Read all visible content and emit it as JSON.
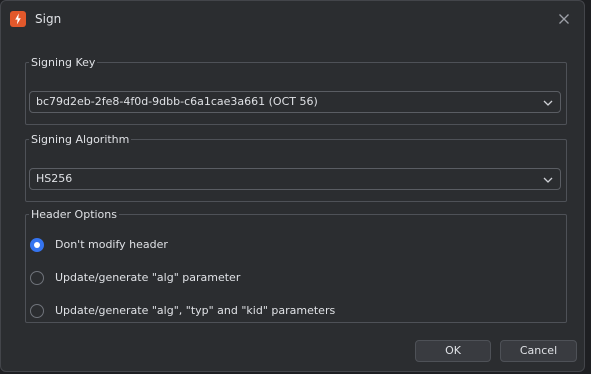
{
  "window": {
    "title": "Sign"
  },
  "signing_key": {
    "legend": "Signing Key",
    "selected": "bc79d2eb-2fe8-4f0d-9dbb-c6a1cae3a661 (OCT 56)"
  },
  "signing_algorithm": {
    "legend": "Signing Algorithm",
    "selected": "HS256"
  },
  "header_options": {
    "legend": "Header Options",
    "options": [
      {
        "label": "Don't modify header",
        "checked": true
      },
      {
        "label": "Update/generate \"alg\" parameter",
        "checked": false
      },
      {
        "label": "Update/generate \"alg\", \"typ\" and \"kid\" parameters",
        "checked": false
      }
    ]
  },
  "buttons": {
    "ok": "OK",
    "cancel": "Cancel"
  },
  "colors": {
    "accent": "#3574f0",
    "app_icon": "#e2582b",
    "background": "#2b2d30"
  }
}
